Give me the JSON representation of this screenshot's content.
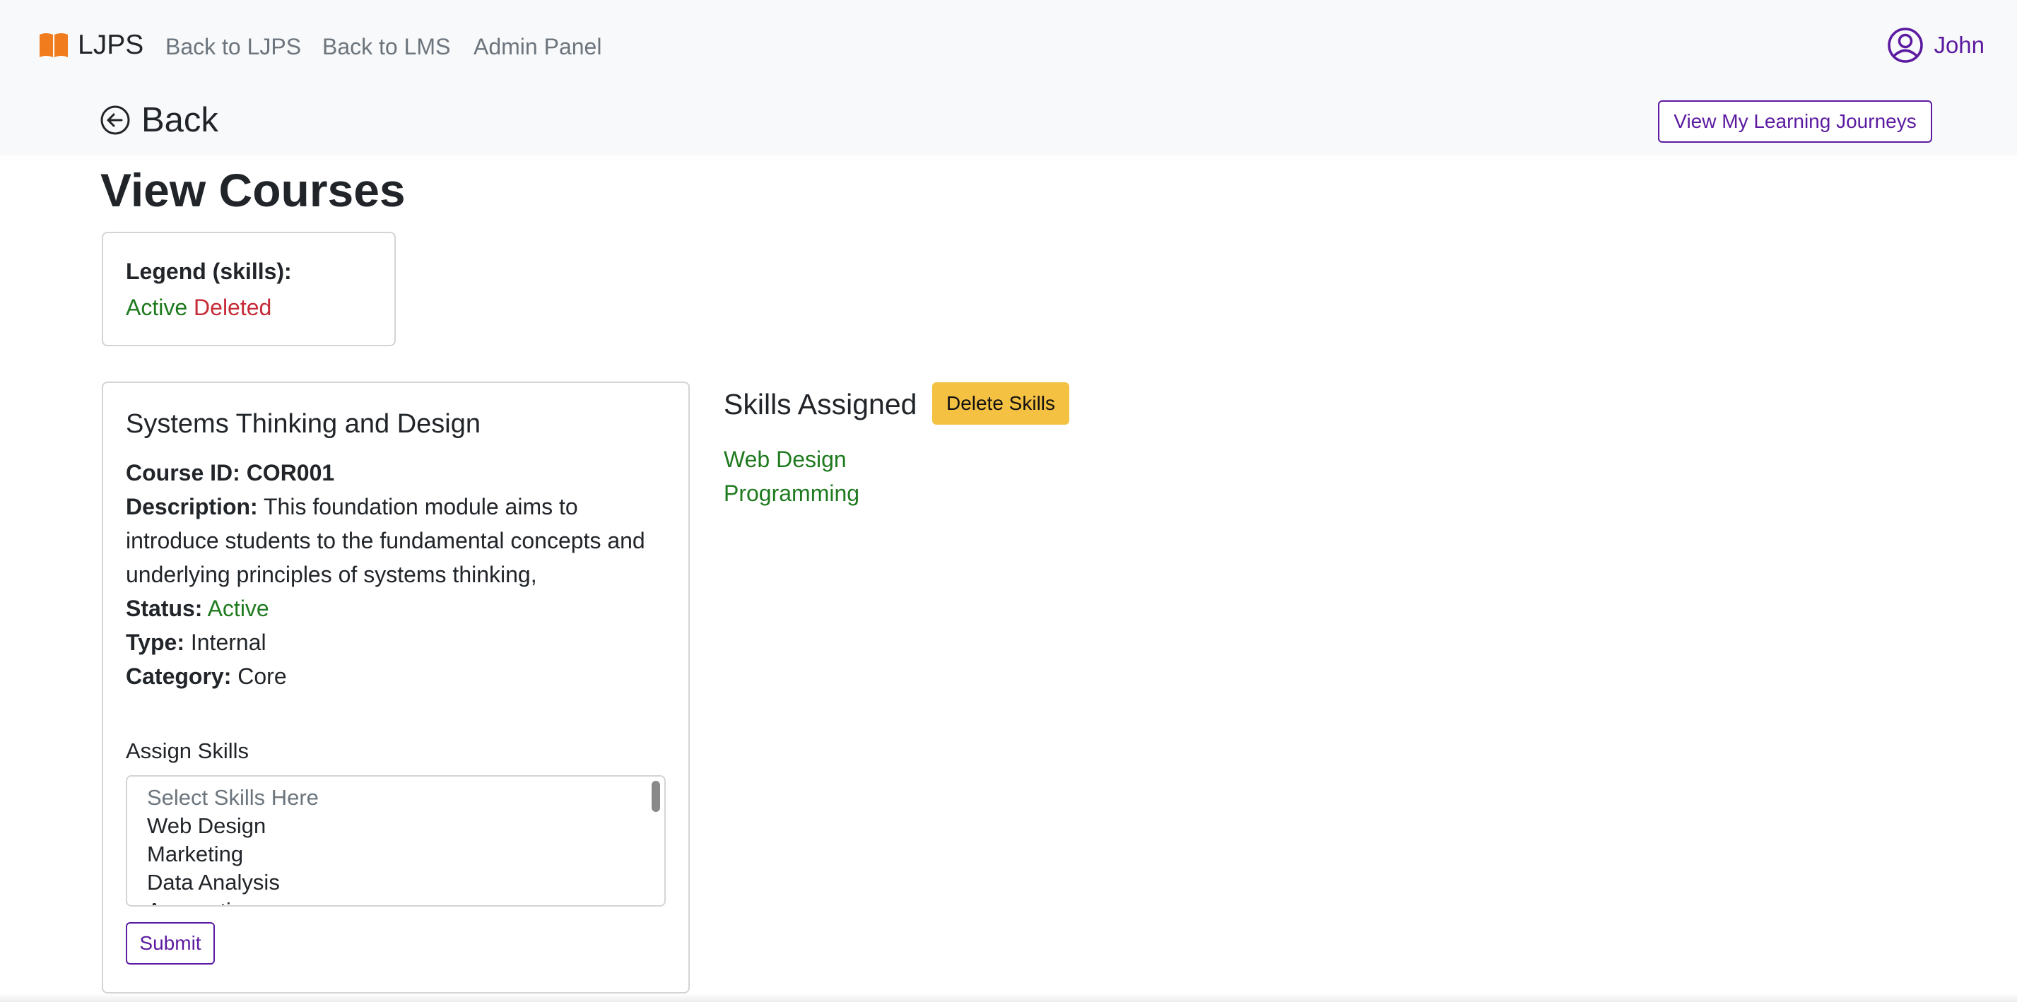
{
  "navbar": {
    "brand": "LJPS",
    "links": [
      "Back to LJPS",
      "Back to LMS",
      "Admin Panel"
    ],
    "user_name": "John",
    "brand_color": "#f07c1e",
    "accent_color": "#5b1aa0"
  },
  "subheader": {
    "back_label": "Back",
    "view_journeys_label": "View My Learning Journeys"
  },
  "page": {
    "title": "View Courses"
  },
  "legend": {
    "title": "Legend (skills):",
    "active_label": "Active",
    "deleted_label": "Deleted",
    "active_color": "#1e7a1e",
    "deleted_color": "#c72a36"
  },
  "course": {
    "name": "Systems Thinking and Design",
    "id_label": "Course ID:",
    "id": "COR001",
    "description_label": "Description:",
    "description": "This foundation module aims to introduce students to the fundamental concepts and underlying principles of systems thinking,",
    "status_label": "Status:",
    "status": "Active",
    "type_label": "Type:",
    "type": "Internal",
    "category_label": "Category:",
    "category": "Core",
    "assign_label": "Assign Skills",
    "select_options": [
      "Select Skills Here",
      "Web Design",
      "Marketing",
      "Data Analysis",
      "Accounting"
    ],
    "submit_label": "Submit"
  },
  "skills_panel": {
    "heading": "Skills Assigned",
    "delete_label": "Delete Skills",
    "skills": [
      "Web Design",
      "Programming"
    ],
    "delete_color": "#f4c142"
  }
}
